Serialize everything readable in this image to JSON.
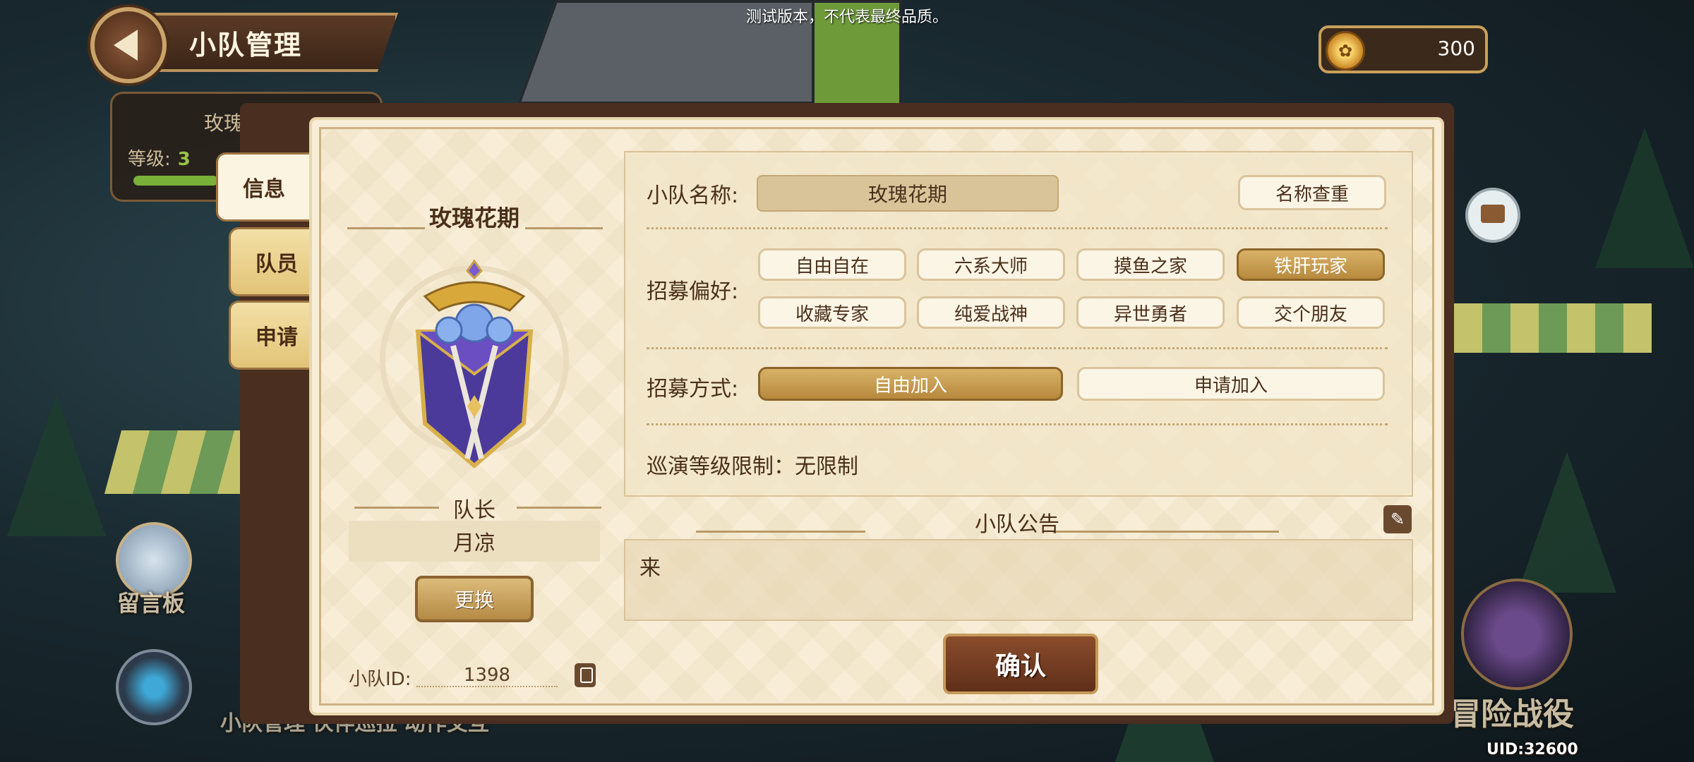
{
  "header": {
    "notice": "测试版本，不代表最终品质。",
    "title": "小队管理",
    "currency_icon": "coin-icon",
    "currency_value": "300"
  },
  "background": {
    "message_board": "留言板",
    "adventure": "冒险战役",
    "uid": "UID:32600",
    "bottom_menu": "小队管理  伙伴巡拉  动作交互"
  },
  "team_card": {
    "name": "玫瑰",
    "level_label": "等级:",
    "level_value": "3"
  },
  "tabs": [
    {
      "label": "信息"
    },
    {
      "label": "队员"
    },
    {
      "label": "申请"
    }
  ],
  "left": {
    "team_name": "玫瑰花期",
    "leader_heading": "队长",
    "leader_name": "月凉",
    "change_button": "更换",
    "id_label": "小队ID:",
    "id_value": "1398"
  },
  "info": {
    "name_label": "小队名称:",
    "name_value": "玫瑰花期",
    "name_check_button": "名称查重",
    "pref_label": "招募偏好:",
    "prefs": [
      {
        "label": "自由自在",
        "selected": false
      },
      {
        "label": "六系大师",
        "selected": false
      },
      {
        "label": "摸鱼之家",
        "selected": false
      },
      {
        "label": "铁肝玩家",
        "selected": true
      },
      {
        "label": "收藏专家",
        "selected": false
      },
      {
        "label": "纯爱战神",
        "selected": false
      },
      {
        "label": "异世勇者",
        "selected": false
      },
      {
        "label": "交个朋友",
        "selected": false
      }
    ],
    "method_label": "招募方式:",
    "methods": [
      {
        "label": "自由加入",
        "selected": true
      },
      {
        "label": "申请加入",
        "selected": false
      }
    ],
    "level_limit": "巡演等级限制：无限制"
  },
  "announcement": {
    "title": "小队公告",
    "text": "来",
    "edit_icon": "pencil-icon"
  },
  "confirm_button": "确认",
  "colors": {
    "accent_gold": "#b7893e",
    "dark_brown": "#5f2f19",
    "panel_cream": "#f8eed8"
  }
}
